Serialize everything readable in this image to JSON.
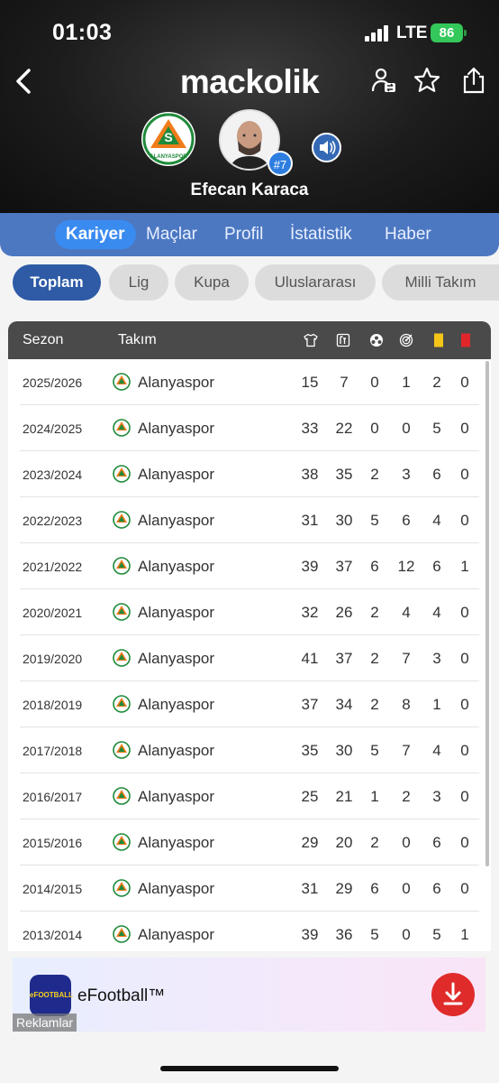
{
  "status": {
    "time": "01:03",
    "network": "LTE",
    "battery": "86"
  },
  "header": {
    "logo": "mackolik",
    "player_name": "Efecan Karaca",
    "shirt_number": "#7",
    "team_badge_text": "ALANYASPOR"
  },
  "main_tabs": [
    {
      "label": "Kariyer",
      "active": true
    },
    {
      "label": "Maçlar",
      "active": false
    },
    {
      "label": "Profil",
      "active": false
    },
    {
      "label": "İstatistik",
      "active": false
    },
    {
      "label": "Haber",
      "active": false
    }
  ],
  "sub_tabs": [
    {
      "label": "Toplam",
      "active": true
    },
    {
      "label": "Lig",
      "active": false
    },
    {
      "label": "Kupa",
      "active": false
    },
    {
      "label": "Uluslararası",
      "active": false
    },
    {
      "label": "Milli Takım",
      "active": false
    }
  ],
  "table": {
    "col_season": "Sezon",
    "col_team": "Takım",
    "stat_icons": [
      "shirt-icon",
      "substitution-icon",
      "ball-icon",
      "target-icon",
      "yellow-card-icon",
      "red-card-icon"
    ],
    "rows": [
      {
        "season": "2025/2026",
        "team": "Alanyaspor",
        "stats": [
          "15",
          "7",
          "0",
          "1",
          "2",
          "0"
        ]
      },
      {
        "season": "2024/2025",
        "team": "Alanyaspor",
        "stats": [
          "33",
          "22",
          "0",
          "0",
          "5",
          "0"
        ]
      },
      {
        "season": "2023/2024",
        "team": "Alanyaspor",
        "stats": [
          "38",
          "35",
          "2",
          "3",
          "6",
          "0"
        ]
      },
      {
        "season": "2022/2023",
        "team": "Alanyaspor",
        "stats": [
          "31",
          "30",
          "5",
          "6",
          "4",
          "0"
        ]
      },
      {
        "season": "2021/2022",
        "team": "Alanyaspor",
        "stats": [
          "39",
          "37",
          "6",
          "12",
          "6",
          "1"
        ]
      },
      {
        "season": "2020/2021",
        "team": "Alanyaspor",
        "stats": [
          "32",
          "26",
          "2",
          "4",
          "4",
          "0"
        ]
      },
      {
        "season": "2019/2020",
        "team": "Alanyaspor",
        "stats": [
          "41",
          "37",
          "2",
          "7",
          "3",
          "0"
        ]
      },
      {
        "season": "2018/2019",
        "team": "Alanyaspor",
        "stats": [
          "37",
          "34",
          "2",
          "8",
          "1",
          "0"
        ]
      },
      {
        "season": "2017/2018",
        "team": "Alanyaspor",
        "stats": [
          "35",
          "30",
          "5",
          "7",
          "4",
          "0"
        ]
      },
      {
        "season": "2016/2017",
        "team": "Alanyaspor",
        "stats": [
          "25",
          "21",
          "1",
          "2",
          "3",
          "0"
        ]
      },
      {
        "season": "2015/2016",
        "team": "Alanyaspor",
        "stats": [
          "29",
          "20",
          "2",
          "0",
          "6",
          "0"
        ]
      },
      {
        "season": "2014/2015",
        "team": "Alanyaspor",
        "stats": [
          "31",
          "29",
          "6",
          "0",
          "6",
          "0"
        ]
      },
      {
        "season": "2013/2014",
        "team": "Alanyaspor",
        "stats": [
          "39",
          "36",
          "5",
          "0",
          "5",
          "1"
        ]
      }
    ]
  },
  "ad": {
    "title": "eFootball™",
    "label": "Reklamlar",
    "icon_text": "eFOOTBALL"
  },
  "colors": {
    "tab_bar": "#4c78c2",
    "active_pill": "#2e5aa6",
    "team_green": "#1f8a3a",
    "team_orange": "#f07c1a"
  }
}
